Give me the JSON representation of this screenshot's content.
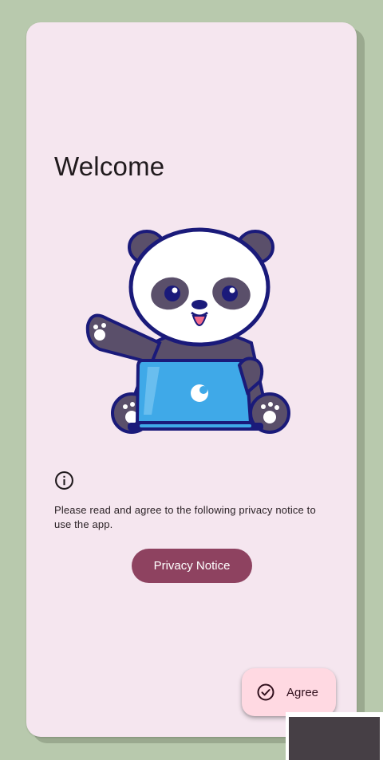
{
  "welcome": {
    "title": "Welcome"
  },
  "illustration": {
    "icon": "panda-with-laptop-illustration"
  },
  "notice": {
    "icon": "info-icon",
    "text": "Please read and agree to the following privacy notice to use the app."
  },
  "privacy_button": {
    "label": "Privacy Notice"
  },
  "agree_button": {
    "icon": "check-circle-icon",
    "label": "Agree"
  },
  "colors": {
    "background": "#b8c9ad",
    "card": "#f5e6ef",
    "primary": "#8e4260",
    "fab": "#ffd9e2",
    "text": "#201a1d"
  }
}
